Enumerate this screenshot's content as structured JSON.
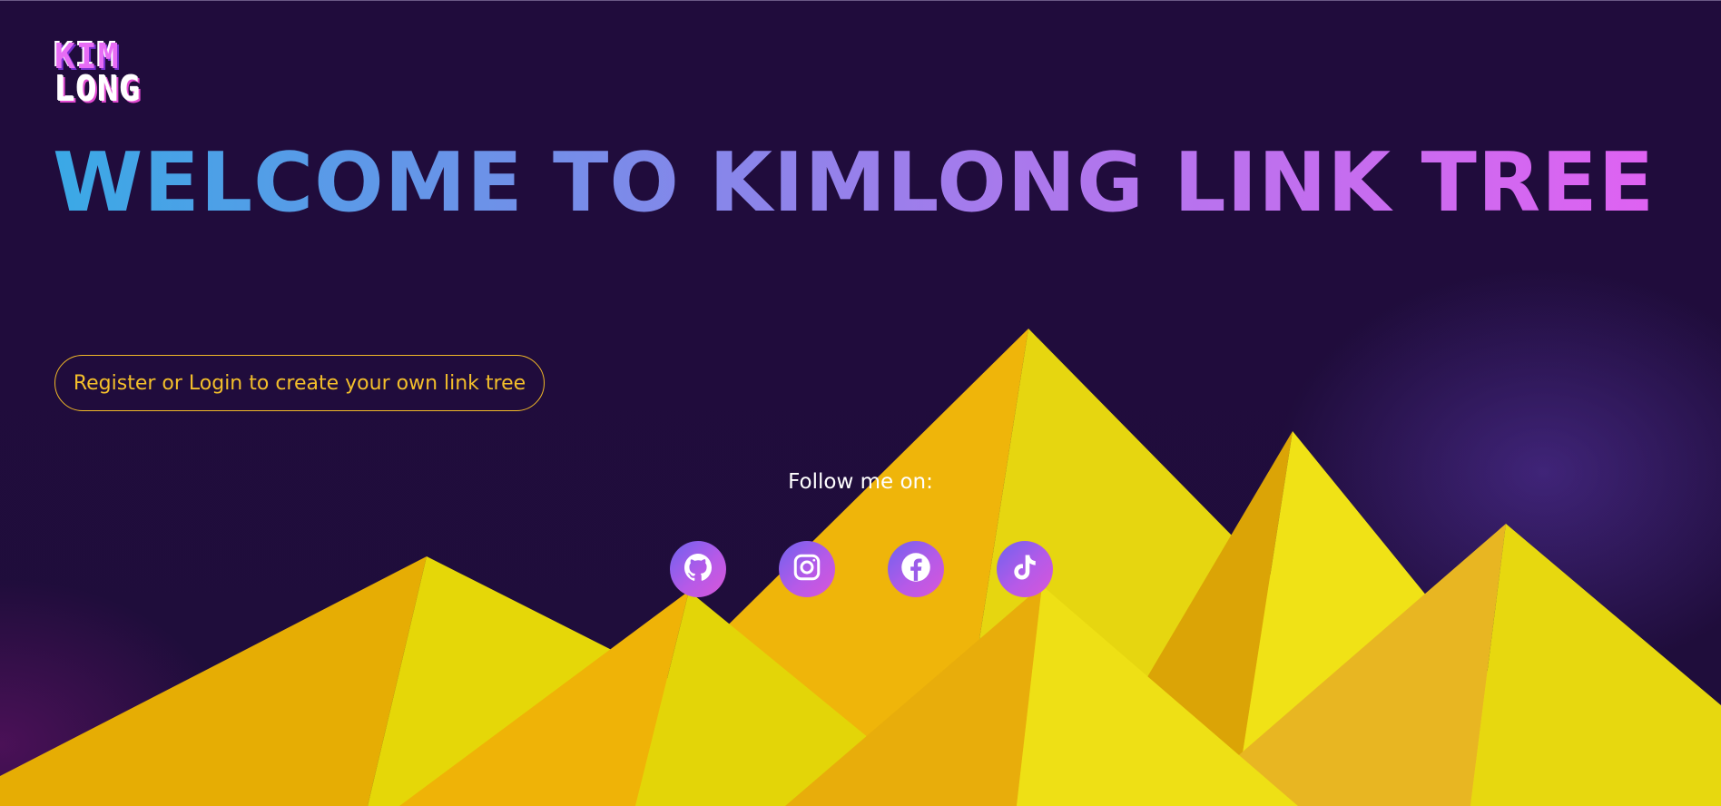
{
  "logo": {
    "line1": "KIM",
    "line2": "LONG"
  },
  "hero": {
    "title": "WELCOME TO KIMLONG LINK TREE"
  },
  "cta": {
    "register_label": "Register or Login to create your own link tree"
  },
  "follow": {
    "label": "Follow me on:"
  },
  "social": [
    {
      "icon": "github-icon",
      "name": "github"
    },
    {
      "icon": "instagram-icon",
      "name": "instagram"
    },
    {
      "icon": "facebook-icon",
      "name": "facebook"
    },
    {
      "icon": "tiktok-icon",
      "name": "tiktok"
    }
  ],
  "colors": {
    "background": "#1f0d3b",
    "accent_yellow": "#f2b928",
    "gradient_start": "#3aa9e6",
    "gradient_end": "#df62f2",
    "mountain_dark": "#e9ae06",
    "mountain_light": "#e8d80a"
  }
}
